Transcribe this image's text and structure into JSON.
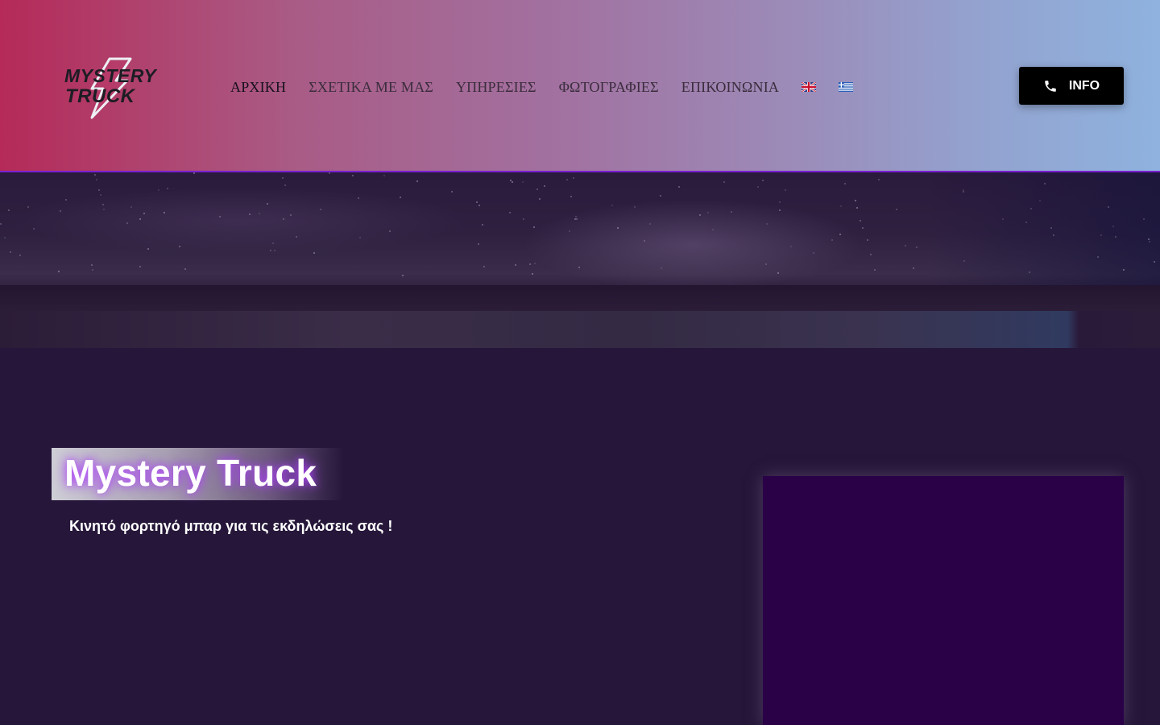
{
  "header": {
    "logo": {
      "line1": "MYSTERY",
      "line2": "TRUCK",
      "icon": "lightning-bolt-icon"
    },
    "nav": [
      {
        "label": "ΑΡΧΙΚΗ",
        "active": true
      },
      {
        "label": "ΣΧΕΤΙΚΑ ΜΕ ΜΑΣ",
        "active": false
      },
      {
        "label": "ΥΠΗΡΕΣΙΕΣ",
        "active": false
      },
      {
        "label": "ΦΩΤΟΓΡΑΦΙΕΣ",
        "active": false
      },
      {
        "label": "ΕΠΙΚΟΙΝΩΝΙΑ",
        "active": false
      }
    ],
    "flags": [
      "uk-flag-icon",
      "greek-flag-icon"
    ],
    "info_button": {
      "label": "INFO",
      "icon": "phone-icon"
    },
    "colors": {
      "gradient_start": "#b52a58",
      "gradient_end": "#8fb2de",
      "border": "#7a1fd0"
    }
  },
  "hero": {
    "title": "Mystery Truck",
    "subtitle": "Κινητό φορτηγό μπαρ για τις εκδηλώσεις σας !"
  },
  "colors": {
    "page_background": "#26173a",
    "video_background": "#2a0047",
    "title_glow": "#b446ff"
  }
}
